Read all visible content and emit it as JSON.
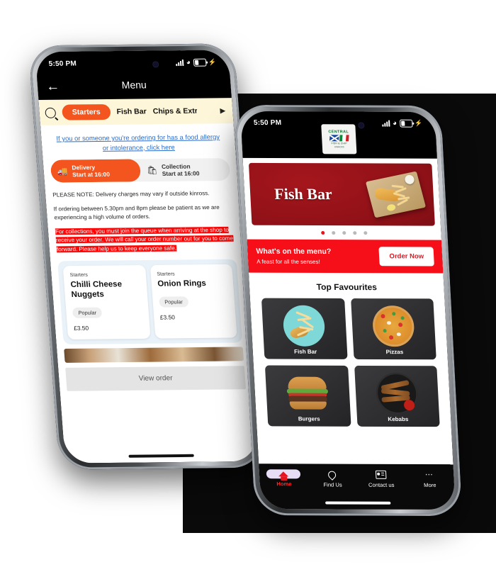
{
  "left_phone": {
    "status_bar": {
      "time": "5:50 PM",
      "icons": [
        "signal-icon",
        "wifi-icon",
        "battery-charging-icon"
      ]
    },
    "header": {
      "back_icon": "back-arrow-icon",
      "title": "Menu"
    },
    "tabs": {
      "search_icon": "search-icon",
      "items": [
        "Starters",
        "Fish Bar",
        "Chips & Extras"
      ],
      "active": "Starters",
      "next_icon": "play-arrow-icon"
    },
    "allergy_link": "If you or someone you're ordering for has a food allergy or intolerance, click here",
    "order_modes": [
      {
        "icon": "delivery-scooter-icon",
        "label": "Delivery",
        "time": "Start at 16:00",
        "active": true
      },
      {
        "icon": "shopping-bag-icon",
        "label": "Collection",
        "time": "Start at 16:00",
        "active": false
      }
    ],
    "notes": {
      "line1": "PLEASE NOTE: Delivery charges may vary if outside kinross.",
      "line2": "If ordering between 5.30pm and 8pm please be patient as we are experiencing a high volume of orders.",
      "highlighted": "For collections, you must join the queue when arriving at the shop to receive your order. We will call your order number out for you to come forward. Please help us to keep everyone safe."
    },
    "products": [
      {
        "category": "Starters",
        "name": "Chilli Cheese Nuggets",
        "badge": "Popular",
        "price": "£3.50"
      },
      {
        "category": "Starters",
        "name": "Onion Rings",
        "badge": "Popular",
        "price": "£3.50"
      }
    ],
    "view_order_label": "View order"
  },
  "right_phone": {
    "status_bar": {
      "time": "5:50 PM",
      "icons": [
        "signal-icon",
        "wifi-icon",
        "battery-charging-icon"
      ]
    },
    "logo": {
      "brand": "CENTRAL",
      "subtitle": "FISH & CHIP",
      "location": "KINROSS"
    },
    "hero": {
      "title": "Fish Bar",
      "image": "fish-and-chips-tray-image",
      "slide_count": 5,
      "active_slide": 1
    },
    "promo": {
      "title": "What's on the menu?",
      "subtitle": "A feast for all the senses!",
      "button": "Order Now"
    },
    "favourites": {
      "title": "Top Favourites",
      "tiles": [
        {
          "label": "Fish Bar",
          "art": "fish-and-chips-plate-image"
        },
        {
          "label": "Pizzas",
          "art": "pizza-image"
        },
        {
          "label": "Burgers",
          "art": "burger-image"
        },
        {
          "label": "Kebabs",
          "art": "kebab-skewers-image"
        }
      ]
    },
    "bottom_nav": [
      {
        "label": "Home",
        "icon": "home-icon",
        "active": true
      },
      {
        "label": "Find Us",
        "icon": "location-pin-icon",
        "active": false
      },
      {
        "label": "Contact us",
        "icon": "contact-card-icon",
        "active": false
      },
      {
        "label": "More",
        "icon": "ellipsis-icon",
        "active": false
      }
    ]
  },
  "colors": {
    "brand_orange": "#F4551E",
    "promo_red": "#F60F18",
    "banner_dark_red": "#8E1117",
    "tab_bar_cream": "#FDF6D8",
    "highlight_red": "#FD0808",
    "link_blue": "#2C6ECB",
    "active_nav_red": "#FF2A2A"
  }
}
